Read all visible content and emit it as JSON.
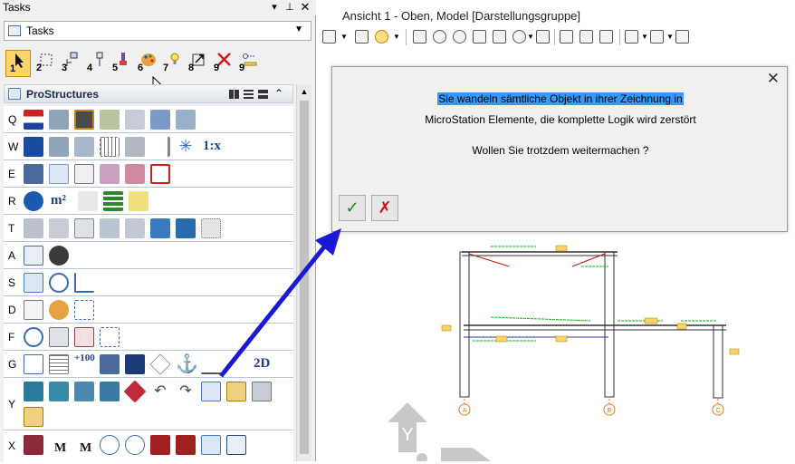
{
  "tasks_panel": {
    "title": "Tasks",
    "dropdown_value": "Tasks",
    "numbered_tools": [
      "1",
      "2",
      "3",
      "4",
      "5",
      "6",
      "7",
      "8",
      "9"
    ],
    "section_title": "ProStructures",
    "rows": [
      "Q",
      "W",
      "E",
      "R",
      "T",
      "A",
      "S",
      "D",
      "F",
      "G",
      "Y",
      "X"
    ],
    "text_tools": {
      "w_scale": "1:x",
      "r_area": "m²",
      "g_elevation": "+100",
      "g_2d": "2D",
      "x_m1": "M",
      "x_m2": "M"
    }
  },
  "view": {
    "title": "Ansicht 1 - Oben, Model [Darstellungsgruppe]"
  },
  "dialog": {
    "close_glyph": "✕",
    "line1": "Sie wandeln sämtliche Objekt in ihrer Zeichnung in",
    "line2": "MicroStation Elemente, die komplette Logik wird zerstört",
    "line3": "Wollen Sie trotzdem weitermachen ?",
    "ok_glyph": "✓",
    "cancel_glyph": "✗"
  },
  "drawing": {
    "grid_labels": [
      "A",
      "B",
      "C"
    ],
    "axis_label": "Y"
  },
  "colors": {
    "highlight": "#3399ff",
    "arrow": "#1a1ad6",
    "ok": "#1a8a1a",
    "cancel": "#d01010",
    "dimension": "#1ea01e",
    "member": "#303030",
    "tag": "#ffd36b"
  }
}
